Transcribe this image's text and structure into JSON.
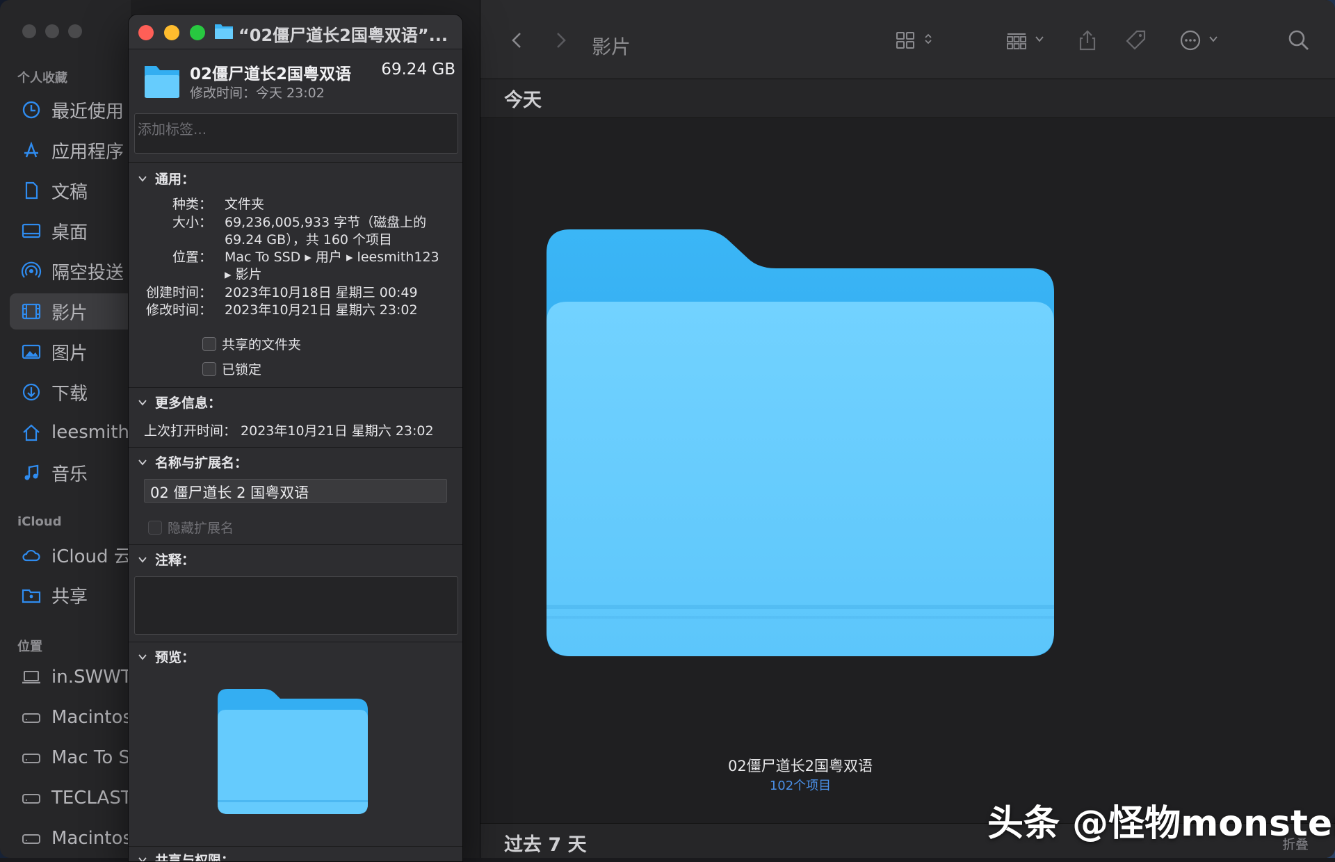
{
  "finder": {
    "location_title": "影片",
    "sidebar": {
      "favorites_heading": "个人收藏",
      "favorites": [
        {
          "label": "最近使用",
          "icon": "clock-icon"
        },
        {
          "label": "应用程序",
          "icon": "apps-icon"
        },
        {
          "label": "文稿",
          "icon": "document-icon"
        },
        {
          "label": "桌面",
          "icon": "desktop-icon"
        },
        {
          "label": "隔空投送",
          "icon": "airdrop-icon"
        },
        {
          "label": "影片",
          "icon": "film-icon",
          "active": true
        },
        {
          "label": "图片",
          "icon": "photo-icon"
        },
        {
          "label": "下载",
          "icon": "download-icon"
        },
        {
          "label": "leesmith",
          "icon": "home-icon"
        },
        {
          "label": "音乐",
          "icon": "music-icon"
        }
      ],
      "icloud_heading": "iCloud",
      "icloud": [
        {
          "label": "iCloud 云",
          "icon": "cloud-icon"
        },
        {
          "label": "共享",
          "icon": "shared-folder-icon"
        }
      ],
      "locations_heading": "位置",
      "locations": [
        {
          "label": "in.SWWT",
          "icon": "laptop-icon"
        },
        {
          "label": "Macintos",
          "icon": "drive-icon"
        },
        {
          "label": "Mac To S",
          "icon": "drive-icon"
        },
        {
          "label": "TECLAST",
          "icon": "drive-icon"
        },
        {
          "label": "Macintos",
          "icon": "drive-icon"
        }
      ]
    },
    "sections": {
      "today": "今天",
      "past_7_days": "过去 7 天",
      "collapse": "折叠"
    },
    "item": {
      "name": "02僵尸道长2国粤双语",
      "count": "102个项目"
    }
  },
  "info": {
    "window_title": "“02僵尸道长2国粤双语”...",
    "name": "02僵尸道长2国粤双语",
    "size": "69.24 GB",
    "modified_label": "修改时间：",
    "modified_value": "今天 23:02",
    "tags_placeholder": "添加标签...",
    "general": {
      "heading": "通用：",
      "kind_label": "种类：",
      "kind_value": "文件夹",
      "size_label": "大小：",
      "size_value_line1": "69,236,005,933 字节（磁盘上的",
      "size_value_line2": "69.24 GB），共 160 个项目",
      "where_label": "位置：",
      "where_value_line1": "Mac To SSD ▸ 用户 ▸ leesmith123",
      "where_value_line2": "▸ 影片",
      "created_label": "创建时间：",
      "created_value": "2023年10月18日 星期三 00:49",
      "modified_label": "修改时间：",
      "modified_value": "2023年10月21日 星期六 23:02",
      "shared_folder": "共享的文件夹",
      "locked": "已锁定"
    },
    "more_info": {
      "heading": "更多信息：",
      "last_opened": "上次打开时间：  2023年10月21日 星期六 23:02"
    },
    "name_ext": {
      "heading": "名称与扩展名：",
      "value": "02 僵尸道长 2 国粤双语",
      "hide_ext": "隐藏扩展名"
    },
    "comments": {
      "heading": "注释："
    },
    "preview": {
      "heading": "预览："
    },
    "sharing": {
      "heading": "共享与权限："
    }
  },
  "watermark": "头条 @怪物monster",
  "colors": {
    "folder_light": "#6cd0ff",
    "folder_dark": "#2d9fe6",
    "accent_blue": "#4a90e8",
    "close": "#fe5f57",
    "minimize": "#febc2e",
    "zoom": "#28c840"
  }
}
